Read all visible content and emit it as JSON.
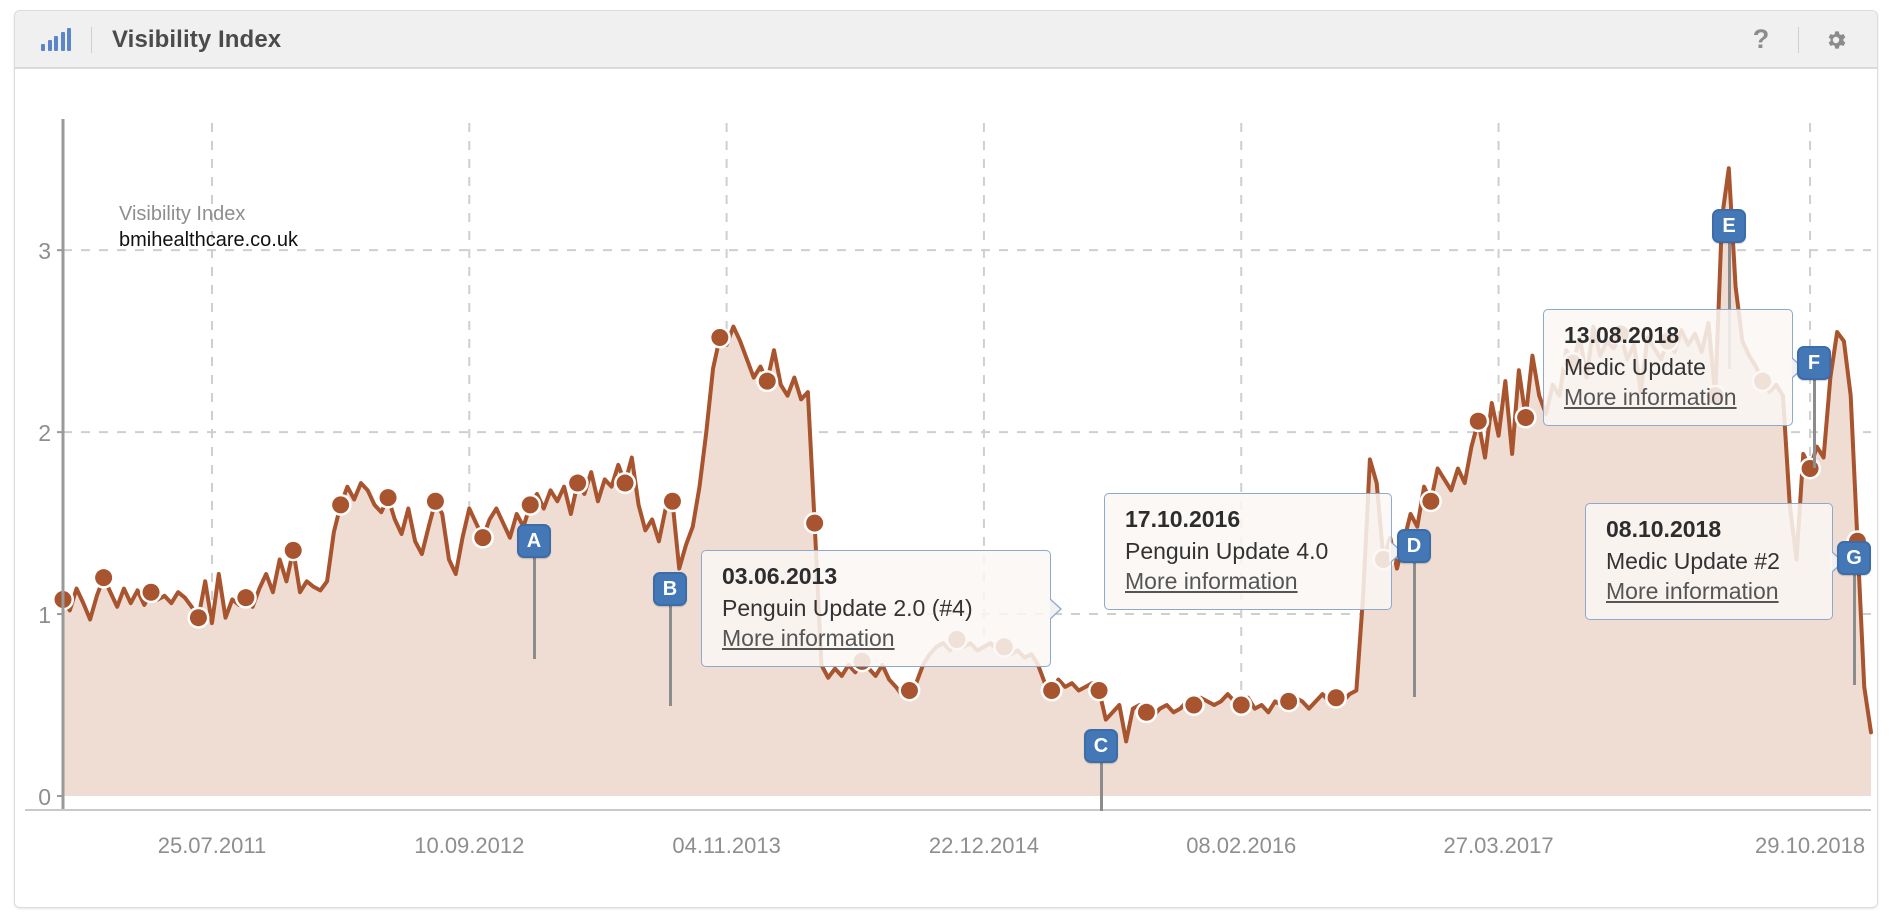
{
  "header": {
    "title": "Visibility Index",
    "logo_icon": "bar-chart-icon",
    "help_icon": "?",
    "settings_icon": "gear-icon"
  },
  "legend": {
    "metric": "Visibility Index",
    "domain": "bmihealthcare.co.uk"
  },
  "colors": {
    "line": "#a8542e",
    "fill": "#efdcd2",
    "marker_blue": "#4477b5",
    "axis_text": "#8e8e8e",
    "grid": "#cfcfcf",
    "header_bg": "#f0f0f0",
    "tooltip_border": "#8fa9cd"
  },
  "markers": [
    {
      "id": "A",
      "label": "A",
      "has_tooltip": false
    },
    {
      "id": "B",
      "label": "B",
      "has_tooltip": true
    },
    {
      "id": "C",
      "label": "C",
      "has_tooltip": false
    },
    {
      "id": "D",
      "label": "D",
      "has_tooltip": true
    },
    {
      "id": "E",
      "label": "E",
      "has_tooltip": false
    },
    {
      "id": "F",
      "label": "F",
      "has_tooltip": true
    },
    {
      "id": "G",
      "label": "G",
      "has_tooltip": true
    }
  ],
  "tooltips": [
    {
      "marker": "B",
      "date": "03.06.2013",
      "name": "Penguin Update 2.0 (#4)",
      "link": "More information"
    },
    {
      "marker": "D",
      "date": "17.10.2016",
      "name": "Penguin Update 4.0",
      "link": "More information"
    },
    {
      "marker": "F",
      "date": "13.08.2018",
      "name": "Medic Update",
      "link": "More information"
    },
    {
      "marker": "G",
      "date": "08.10.2018",
      "name": "Medic Update #2",
      "link": "More information"
    }
  ],
  "chart_data": {
    "type": "area",
    "title": "Visibility Index",
    "series_name": "bmihealthcare.co.uk",
    "xlabel": "",
    "ylabel": "Visibility Index",
    "ylim": [
      0,
      3.6
    ],
    "yticks": [
      0,
      1,
      2,
      3
    ],
    "ytick_labels": [
      "0",
      "1",
      "2",
      "3"
    ],
    "grid": true,
    "legend_position": "top-left",
    "xtick_labels": [
      "25.07.2011",
      "10.09.2012",
      "04.11.2013",
      "22.12.2014",
      "08.02.2016",
      "27.03.2017",
      "29.10.2018"
    ],
    "xtick_index": [
      22,
      60,
      98,
      136,
      174,
      212,
      258
    ],
    "x_count": 268,
    "values": [
      1.08,
      1.02,
      1.14,
      1.06,
      0.97,
      1.1,
      1.2,
      1.12,
      1.04,
      1.14,
      1.06,
      1.13,
      1.05,
      1.12,
      1.08,
      1.1,
      1.06,
      1.12,
      1.09,
      1.04,
      0.98,
      1.18,
      0.95,
      1.22,
      0.98,
      1.08,
      1.05,
      1.09,
      1.04,
      1.14,
      1.22,
      1.12,
      1.3,
      1.18,
      1.35,
      1.12,
      1.18,
      1.15,
      1.13,
      1.18,
      1.45,
      1.6,
      1.7,
      1.63,
      1.72,
      1.68,
      1.6,
      1.56,
      1.64,
      1.52,
      1.44,
      1.58,
      1.4,
      1.33,
      1.48,
      1.62,
      1.55,
      1.3,
      1.22,
      1.42,
      1.58,
      1.5,
      1.42,
      1.52,
      1.58,
      1.5,
      1.42,
      1.55,
      1.48,
      1.6,
      1.66,
      1.58,
      1.68,
      1.62,
      1.7,
      1.55,
      1.72,
      1.66,
      1.78,
      1.62,
      1.74,
      1.7,
      1.82,
      1.72,
      1.86,
      1.6,
      1.46,
      1.52,
      1.4,
      1.58,
      1.62,
      1.25,
      1.38,
      1.48,
      1.7,
      2.0,
      2.35,
      2.52,
      2.48,
      2.58,
      2.5,
      2.4,
      2.3,
      2.36,
      2.28,
      2.45,
      2.26,
      2.2,
      2.3,
      2.18,
      2.22,
      1.5,
      0.72,
      0.65,
      0.7,
      0.66,
      0.72,
      0.68,
      0.74,
      0.7,
      0.66,
      0.72,
      0.64,
      0.6,
      0.55,
      0.58,
      0.62,
      0.72,
      0.78,
      0.82,
      0.84,
      0.8,
      0.86,
      0.82,
      0.84,
      0.8,
      0.82,
      0.84,
      0.8,
      0.82,
      0.78,
      0.8,
      0.76,
      0.78,
      0.72,
      0.62,
      0.58,
      0.64,
      0.6,
      0.62,
      0.58,
      0.6,
      0.62,
      0.58,
      0.42,
      0.46,
      0.5,
      0.3,
      0.48,
      0.5,
      0.46,
      0.44,
      0.48,
      0.5,
      0.46,
      0.48,
      0.52,
      0.5,
      0.54,
      0.52,
      0.5,
      0.52,
      0.56,
      0.52,
      0.5,
      0.54,
      0.48,
      0.5,
      0.46,
      0.52,
      0.5,
      0.52,
      0.54,
      0.52,
      0.48,
      0.52,
      0.56,
      0.52,
      0.54,
      0.52,
      0.56,
      0.58,
      1.1,
      1.85,
      1.72,
      1.3,
      1.42,
      1.25,
      1.4,
      1.55,
      1.48,
      1.7,
      1.62,
      1.8,
      1.74,
      1.68,
      1.8,
      1.72,
      1.92,
      2.06,
      1.86,
      2.16,
      1.98,
      2.28,
      1.88,
      2.34,
      2.08,
      2.42,
      2.2,
      2.1,
      2.26,
      2.2,
      2.45,
      2.38,
      2.52,
      2.3,
      2.58,
      2.42,
      2.5,
      2.46,
      2.54,
      2.4,
      2.48,
      2.22,
      2.52,
      2.46,
      2.4,
      2.5,
      2.44,
      2.56,
      2.48,
      2.54,
      2.44,
      2.6,
      2.2,
      3.18,
      3.45,
      2.8,
      2.5,
      2.42,
      2.36,
      2.28,
      2.22,
      2.26,
      2.2,
      1.6,
      1.3,
      1.88,
      1.8,
      1.92,
      1.86,
      2.3,
      2.55,
      2.5,
      2.2,
      1.4,
      0.6,
      0.35
    ],
    "dot_indices": [
      0,
      6,
      13,
      20,
      27,
      34,
      41,
      48,
      55,
      62,
      69,
      76,
      83,
      90,
      97,
      104,
      111,
      118,
      125,
      132,
      139,
      146,
      153,
      160,
      167,
      174,
      181,
      188,
      195,
      202,
      209,
      216,
      223,
      230,
      237,
      244,
      251,
      258,
      265
    ]
  }
}
